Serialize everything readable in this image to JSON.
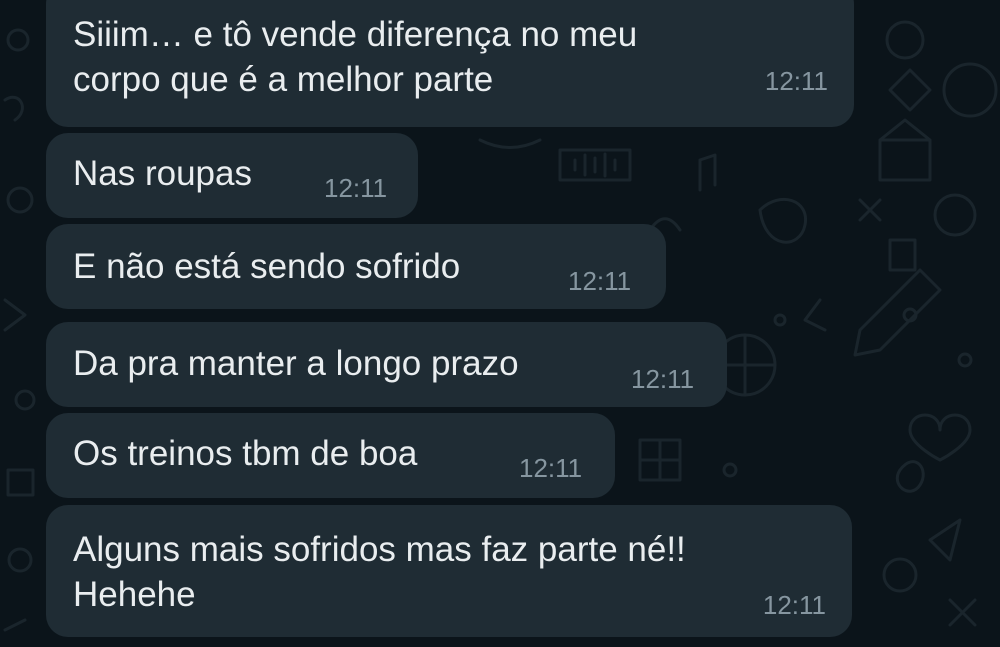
{
  "colors": {
    "background": "#0b141a",
    "bubble_incoming": "#1f2c34",
    "message_text": "#e9edef",
    "timestamp_text": "#8696a0",
    "wallpaper_doodle": "#1a252c"
  },
  "messages": [
    {
      "text": "Siiim… e tô vende diferença no meu\ncorpo que é a melhor parte",
      "time": "12:11"
    },
    {
      "text": "Nas roupas",
      "time": "12:11"
    },
    {
      "text": "E não está sendo sofrido",
      "time": "12:11"
    },
    {
      "text": "Da pra manter a longo prazo",
      "time": "12:11"
    },
    {
      "text": "Os treinos tbm de boa",
      "time": "12:11"
    },
    {
      "text": "Alguns mais sofridos mas faz parte né!!\nHehehe",
      "time": "12:11"
    }
  ]
}
